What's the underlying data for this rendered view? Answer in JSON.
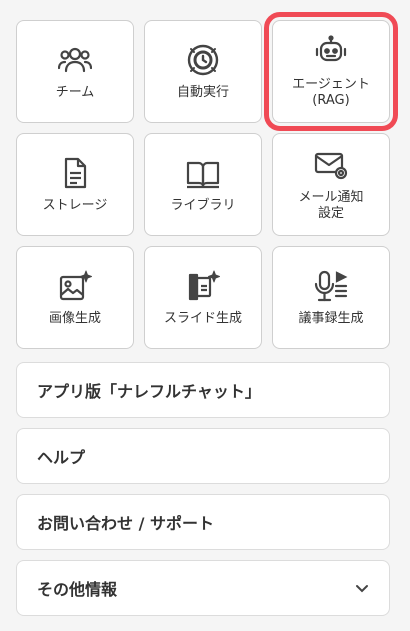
{
  "tiles": [
    {
      "label": "チーム",
      "icon": "users-icon"
    },
    {
      "label": "自動実行",
      "icon": "auto-run-clock-icon"
    },
    {
      "label": "エージェント\n(RAG)",
      "icon": "robot-icon"
    },
    {
      "label": "ストレージ",
      "icon": "document-icon"
    },
    {
      "label": "ライブラリ",
      "icon": "book-icon"
    },
    {
      "label": "メール通知\n設定",
      "icon": "mail-settings-icon"
    },
    {
      "label": "画像生成",
      "icon": "image-sparkle-icon"
    },
    {
      "label": "スライド生成",
      "icon": "slides-sparkle-icon"
    },
    {
      "label": "議事録生成",
      "icon": "microphone-minutes-icon"
    }
  ],
  "menu": [
    {
      "label": "アプリ版「ナレフルチャット」"
    },
    {
      "label": "ヘルプ"
    },
    {
      "label": "お問い合わせ / サポート"
    },
    {
      "label": "その他情報"
    }
  ],
  "colors": {
    "highlight": "#f04a55",
    "icon": "#444444"
  }
}
